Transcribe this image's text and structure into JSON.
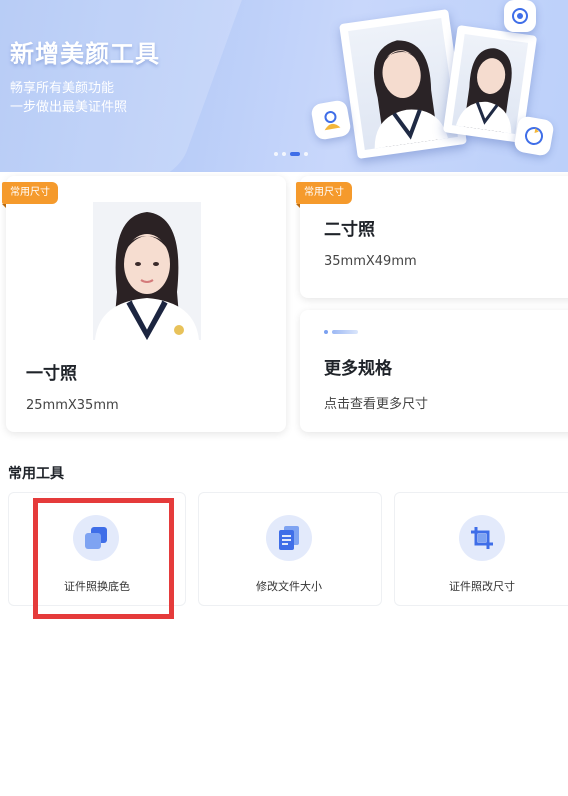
{
  "banner": {
    "title": "新增美颜工具",
    "subtitle_1": "畅享所有美颜功能",
    "subtitle_2": "一步做出最美证件照",
    "active_dot_index": 2
  },
  "sizes": {
    "one_inch": {
      "tag": "常用尺寸",
      "title": "一寸照",
      "dimensions": "25mmX35mm"
    },
    "two_inch": {
      "tag": "常用尺寸",
      "title": "二寸照",
      "dimensions": "35mmX49mm"
    },
    "more": {
      "title": "更多规格",
      "subtitle": "点击查看更多尺寸"
    }
  },
  "tools": {
    "section_title": "常用工具",
    "items": [
      {
        "label": "证件照换底色",
        "icon": "layers-icon"
      },
      {
        "label": "修改文件大小",
        "icon": "document-icon"
      },
      {
        "label": "证件照改尺寸",
        "icon": "crop-icon"
      }
    ]
  },
  "colors": {
    "accent": "#3f6ee8",
    "tag": "#f59a2c",
    "highlight": "#e53b3b",
    "tool_icon_bg": "#e3eafb"
  }
}
